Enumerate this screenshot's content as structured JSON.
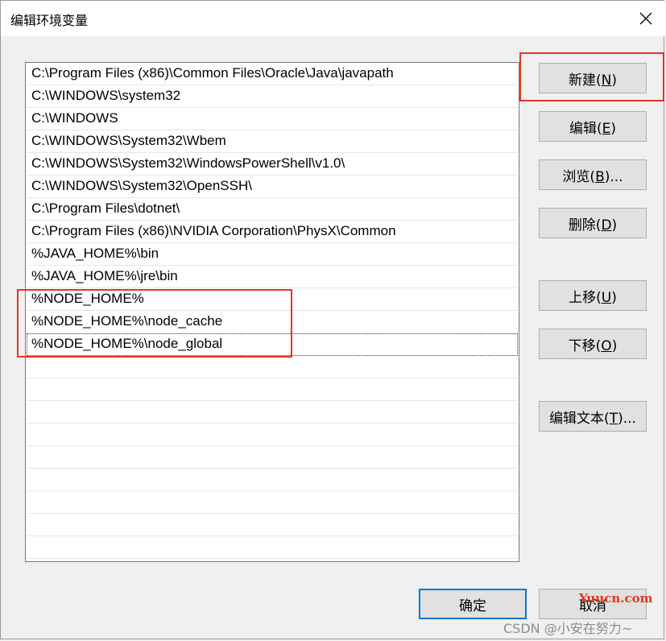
{
  "window": {
    "title": "编辑环境变量",
    "close_icon": "close-icon"
  },
  "path_list": {
    "items": [
      "C:\\Program Files (x86)\\Common Files\\Oracle\\Java\\javapath",
      "C:\\WINDOWS\\system32",
      "C:\\WINDOWS",
      "C:\\WINDOWS\\System32\\Wbem",
      "C:\\WINDOWS\\System32\\WindowsPowerShell\\v1.0\\",
      "C:\\WINDOWS\\System32\\OpenSSH\\",
      "C:\\Program Files\\dotnet\\",
      "C:\\Program Files (x86)\\NVIDIA Corporation\\PhysX\\Common",
      "%JAVA_HOME%\\bin",
      "%JAVA_HOME%\\jre\\bin",
      "%NODE_HOME%",
      "%NODE_HOME%\\node_cache",
      "%NODE_HOME%\\node_global"
    ],
    "focused_index": 12
  },
  "buttons": {
    "new": {
      "text": "新建(",
      "key": "N",
      "end": ")"
    },
    "edit": {
      "text": "编辑(",
      "key": "E",
      "end": ")"
    },
    "browse": {
      "text": "浏览(",
      "key": "B",
      "end": ")..."
    },
    "delete": {
      "text": "删除(",
      "key": "D",
      "end": ")"
    },
    "move_up": {
      "text": "上移(",
      "key": "U",
      "end": ")"
    },
    "move_down": {
      "text": "下移(",
      "key": "O",
      "end": ")"
    },
    "edit_text": {
      "text": "编辑文本(",
      "key": "T",
      "end": ")..."
    },
    "ok": "确定",
    "cancel": "取消"
  },
  "annotation_color": "#e8331f",
  "watermarks": {
    "site": "Yuucn.com",
    "author": "CSDN @小安在努力~"
  }
}
